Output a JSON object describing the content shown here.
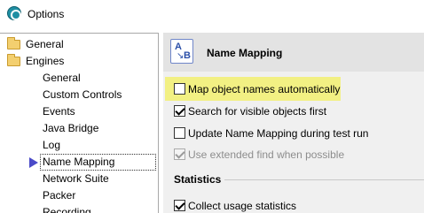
{
  "window": {
    "title": "Options",
    "icon": "options-app-icon"
  },
  "tree": {
    "items": [
      {
        "label": "General",
        "icon": "folder-icon"
      },
      {
        "label": "Engines",
        "icon": "folder-open-icon"
      },
      {
        "label": "General"
      },
      {
        "label": "Custom Controls"
      },
      {
        "label": "Events"
      },
      {
        "label": "Java Bridge"
      },
      {
        "label": "Log"
      },
      {
        "label": "Name Mapping",
        "selected": true,
        "marker": "selection-arrow-icon"
      },
      {
        "label": "Network Suite"
      },
      {
        "label": "Packer"
      },
      {
        "label": "Recording"
      }
    ]
  },
  "panel": {
    "title": "Name Mapping",
    "icon": "name-mapping-icon",
    "icon_text_a": "A",
    "icon_text_b": "B",
    "options": [
      {
        "label": "Map object names automatically",
        "checked": false,
        "disabled": false,
        "highlighted": true
      },
      {
        "label": "Search for visible objects first",
        "checked": true,
        "disabled": false
      },
      {
        "label": "Update Name Mapping during test run",
        "checked": false,
        "disabled": false
      },
      {
        "label": "Use extended find when possible",
        "checked": true,
        "disabled": true
      }
    ],
    "statistics": {
      "title": "Statistics",
      "options": [
        {
          "label": "Collect usage statistics",
          "checked": true
        }
      ]
    }
  },
  "colors": {
    "highlight": "#f2f083",
    "panel_bg": "#f0f0f0",
    "header_bg": "#e3e3e3",
    "selection_arrow": "#4a4ac8"
  }
}
